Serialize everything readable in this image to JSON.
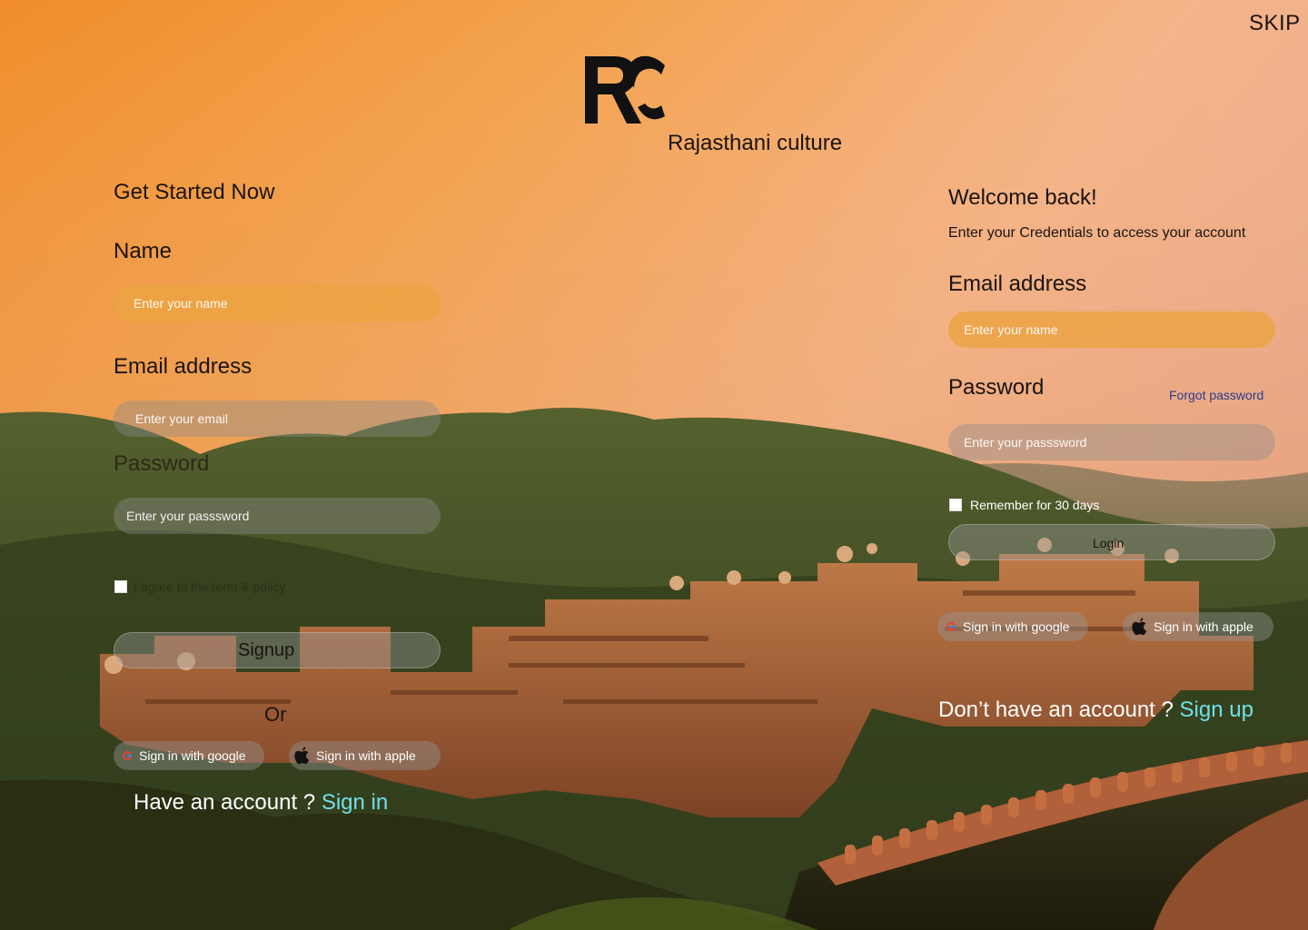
{
  "header": {
    "skip_label": "SKIP"
  },
  "brand": {
    "logo_text": "RC",
    "name": "Rajasthani culture"
  },
  "signup": {
    "title": "Get Started Now",
    "name_label": "Name",
    "name_placeholder": "Enter your name",
    "email_label": "Email address",
    "email_placeholder": "Enter your email",
    "password_label": "Password",
    "password_placeholder": "Enter your passsword",
    "terms_label": "I agree to the term & policy",
    "signup_button": "Signup",
    "or_label": "Or",
    "google_button": "Sign in with google",
    "apple_button": "Sign in with apple",
    "have_account_text": "Have an account ?",
    "signin_link": "Sign in"
  },
  "login": {
    "title": "Welcome back!",
    "subtitle": "Enter your Credentials to access your account",
    "email_label": "Email address",
    "email_placeholder": "Enter your name",
    "password_label": "Password",
    "forgot_password": "Forgot password",
    "password_placeholder": "Enter your passsword",
    "remember_label": "Remember for 30 days",
    "login_button": "Login",
    "google_button": "Sign in with google",
    "apple_button": "Sign in with apple",
    "no_account_text": "Don’t have an account ?",
    "signup_link": "Sign up"
  },
  "colors": {
    "sky_top": "#f2a24a",
    "sky_mid": "#e9a25f",
    "hills": "#3c4a24",
    "fort": "#a8653a",
    "input_orange": "#eca442",
    "link_blue": "#6fe0e8",
    "forgot_blue": "#2b3a8f"
  }
}
